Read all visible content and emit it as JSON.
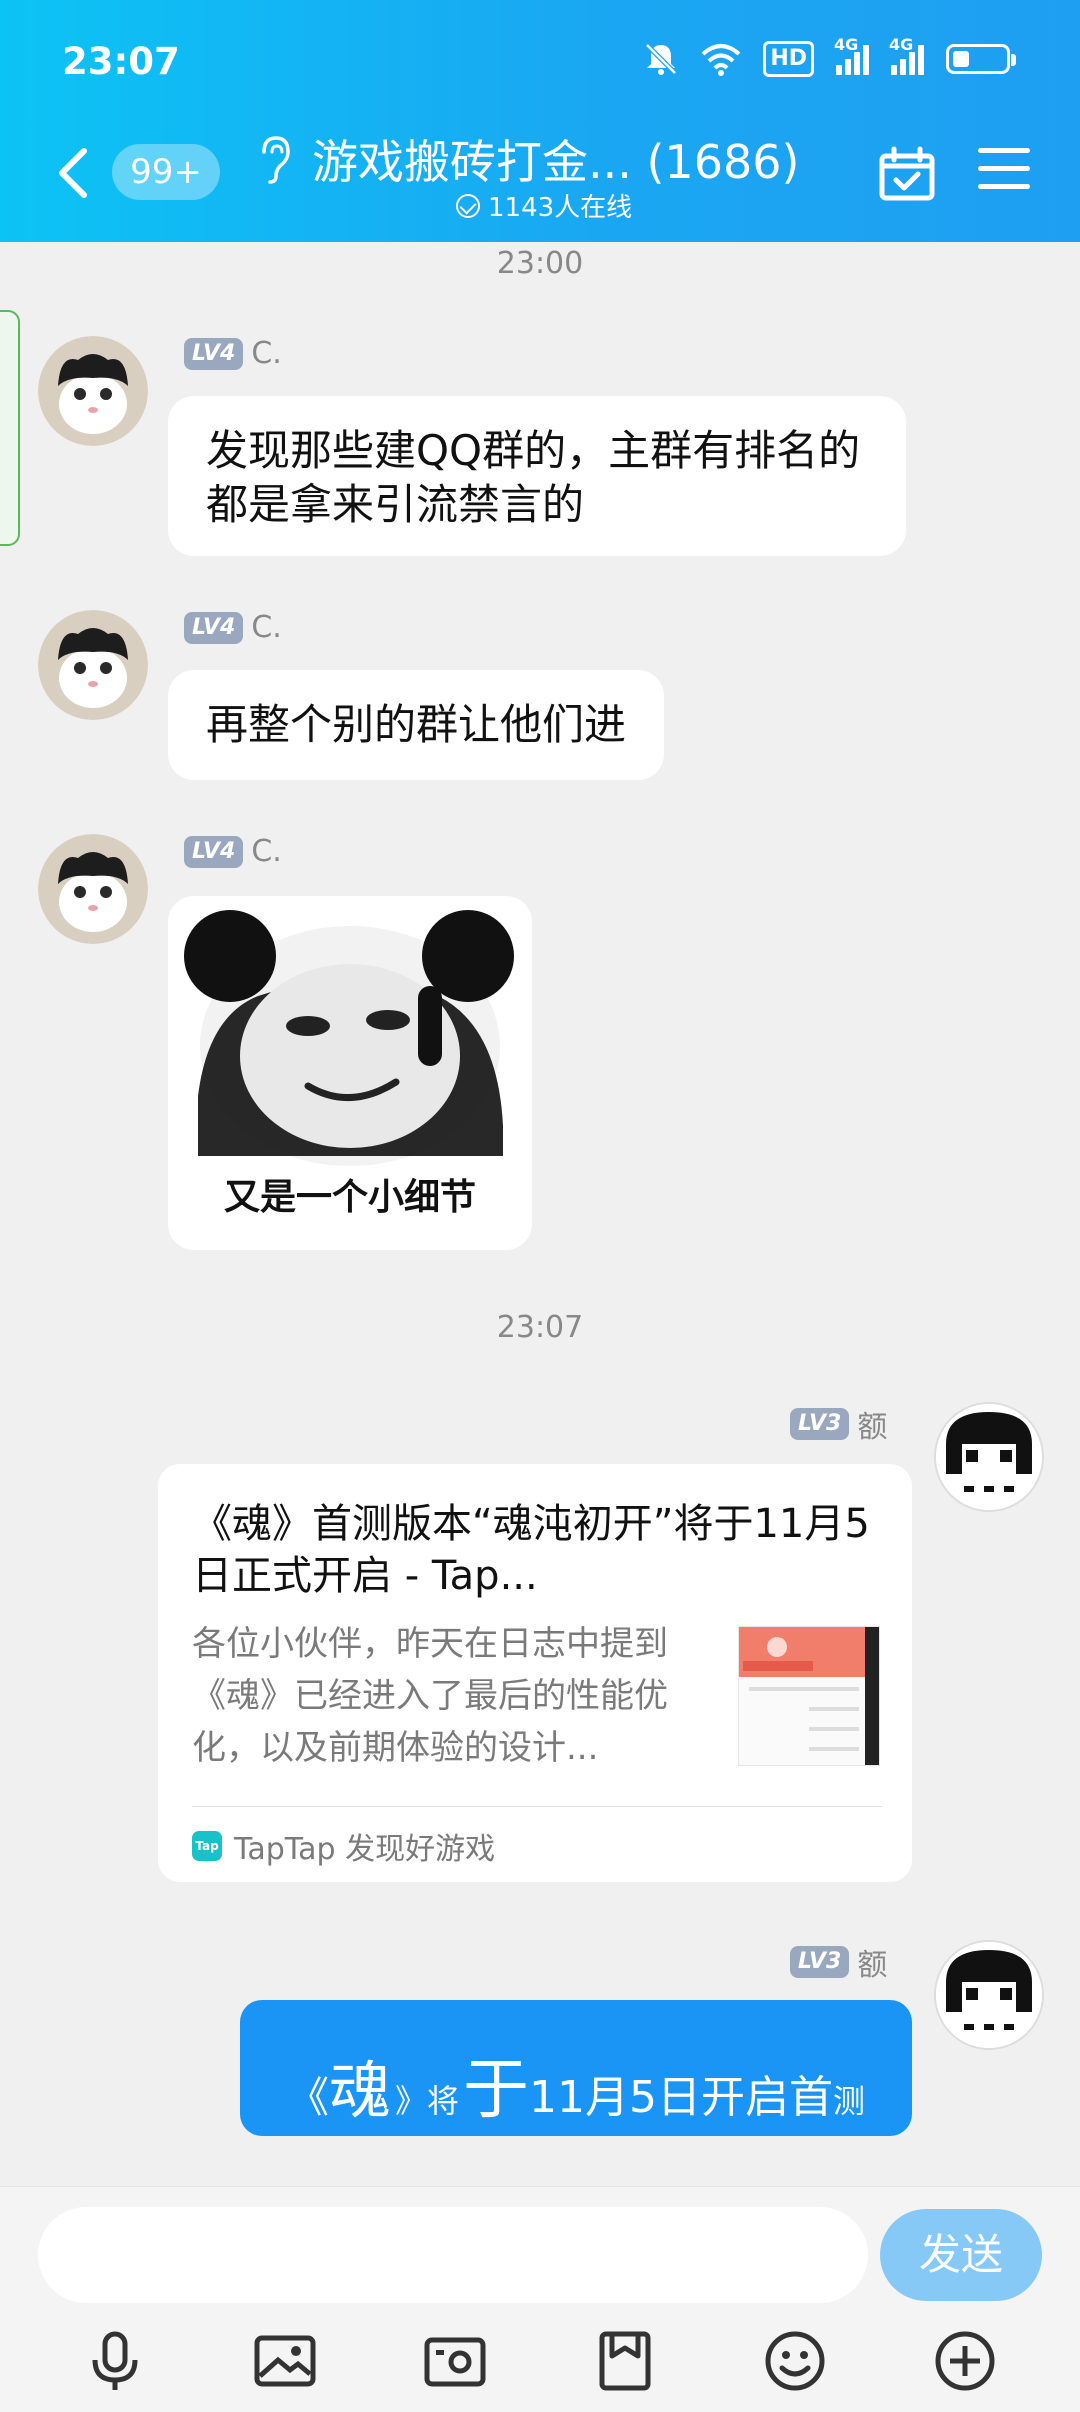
{
  "status_bar": {
    "time": "23:07",
    "hd_badge": "HD",
    "sig1": "4G",
    "sig2": "4G"
  },
  "header": {
    "back_icon": "chevron-left-icon",
    "unread_count": "99+",
    "group_title": "游戏搬砖打金... (1686)",
    "online_text": "1143人在线",
    "accent_color": "#1aa7f2"
  },
  "messages": [
    {
      "timestamp": "23:00"
    },
    {
      "sender_level": "LV4",
      "sender_name": "C.",
      "text": "发现那些建QQ群的，主群有排名的都是拿来引流禁言的"
    },
    {
      "sender_level": "LV4",
      "sender_name": "C.",
      "text": "再整个别的群让他们进"
    },
    {
      "sender_level": "LV4",
      "sender_name": "C.",
      "sticker_caption": "又是一个小细节"
    },
    {
      "timestamp": "23:07"
    },
    {
      "sender_level": "LV3",
      "sender_name": "额",
      "card": {
        "title": "《魂》首测版本“魂沌初开”将于11月5日正式开启 - Tap...",
        "desc": "各位小伙伴，昨天在日志中提到《魂》已经进入了最后的性能优化，以及前期体验的设计...",
        "source": "TapTap 发现好游戏",
        "source_logo": "Tap"
      }
    },
    {
      "sender_level": "LV3",
      "sender_name": "额",
      "styled_text": [
        "《",
        "魂",
        "》将",
        "于",
        "11月5日开启首",
        "测"
      ]
    }
  ],
  "input": {
    "value": "",
    "placeholder": "",
    "send_label": "发送"
  },
  "toolbar": [
    "mic-icon",
    "image-icon",
    "camera-icon",
    "file-icon",
    "emoji-icon",
    "plus-icon"
  ]
}
